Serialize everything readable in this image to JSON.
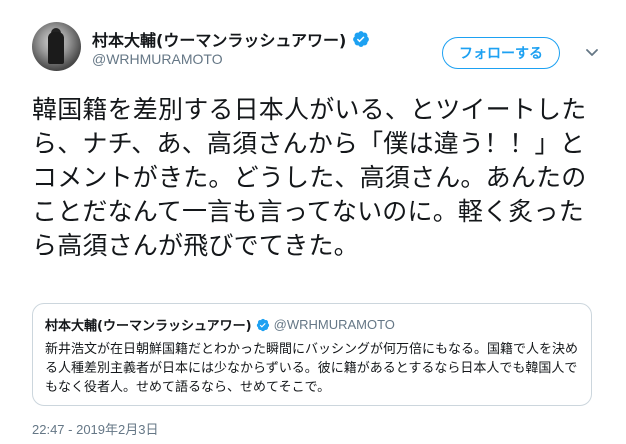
{
  "tweet": {
    "author": {
      "display_name": "村本大輔(ウーマンラッシュアワー)",
      "handle": "@WRHMURAMOTO",
      "verified": true
    },
    "follow_label": "フォローする",
    "text": "韓国籍を差別する日本人がいる、とツイートしたら、ナチ、あ、高須さんから「僕は違う！！」とコメントがきた。どうした、高須さん。あんたのことだなんて一言も言ってないのに。軽く炙ったら高須さんが飛びでてきた。",
    "timestamp": "22:47 - 2019年2月3日"
  },
  "quoted_tweet": {
    "display_name": "村本大輔(ウーマンラッシュアワー)",
    "handle": "@WRHMURAMOTO",
    "verified": true,
    "text": "新井浩文が在日朝鮮国籍だとわかった瞬間にバッシングが何万倍にもなる。国籍で人を決める人種差別主義者が日本には少なからずいる。彼に籍があるとするなら日本人でも韓国人でもなく役者人。せめて語るなら、せめてそこで。"
  },
  "icons": {
    "verified": "verified-badge-icon",
    "caret": "chevron-down-icon"
  },
  "colors": {
    "accent": "#1da1f2",
    "text": "#14171a",
    "muted": "#657786",
    "border": "#ccd6dd"
  }
}
